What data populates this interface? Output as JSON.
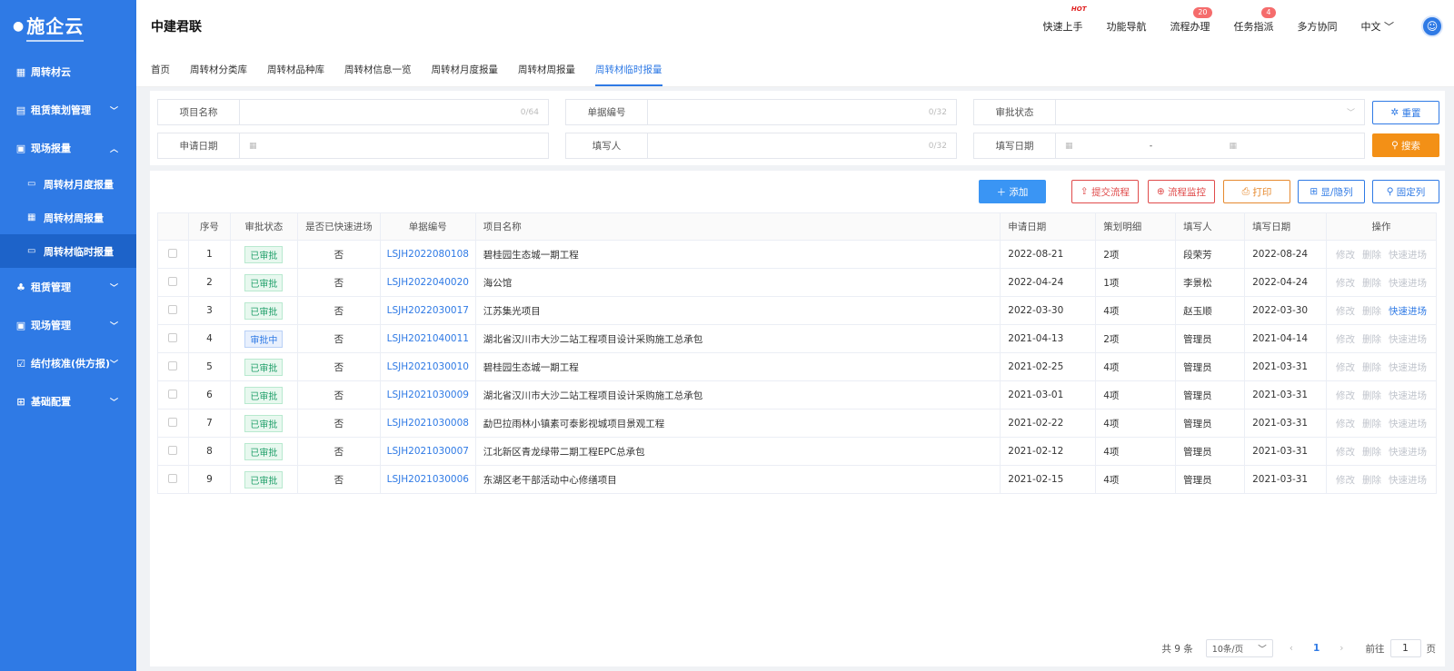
{
  "sidebar": {
    "logo": "施企云",
    "items": [
      {
        "label": "周转材云",
        "icon": "grid-icon"
      },
      {
        "label": "租赁策划管理",
        "icon": "doc-icon"
      },
      {
        "label": "现场报量",
        "icon": "form-icon"
      },
      {
        "label": "周转材月度报量",
        "icon": "doc-search-icon"
      },
      {
        "label": "周转材周报量",
        "icon": "calendar-icon"
      },
      {
        "label": "周转材临时报量",
        "icon": "card-icon"
      },
      {
        "label": "租赁管理",
        "icon": "org-icon"
      },
      {
        "label": "现场管理",
        "icon": "form-icon"
      },
      {
        "label": "结付核准(供方报)",
        "icon": "clipboard-check-icon"
      },
      {
        "label": "基础配置",
        "icon": "apps-icon"
      }
    ]
  },
  "header": {
    "company": "中建君联",
    "nav": [
      {
        "label": "快速上手",
        "tag": "HOT"
      },
      {
        "label": "功能导航"
      },
      {
        "label": "流程办理",
        "badge": "20"
      },
      {
        "label": "任务指派",
        "badge": "4"
      },
      {
        "label": "多方协同"
      },
      {
        "label": "中文"
      }
    ]
  },
  "tabs": [
    "首页",
    "周转材分类库",
    "周转材品种库",
    "周转材信息一览",
    "周转材月度报量",
    "周转材周报量",
    "周转材临时报量"
  ],
  "filters": {
    "project_name": {
      "label": "项目名称",
      "count": "0/64"
    },
    "doc_no": {
      "label": "单据编号",
      "count": "0/32"
    },
    "approval": {
      "label": "审批状态"
    },
    "apply_date": {
      "label": "申请日期"
    },
    "filler": {
      "label": "填写人",
      "count": "0/32"
    },
    "fill_date": {
      "label": "填写日期",
      "sep": "-"
    },
    "reset": "重置",
    "search": "搜索"
  },
  "toolbar": {
    "add": "添加",
    "submit": "提交流程",
    "monitor": "流程监控",
    "print": "打印",
    "toggle_cols": "显/隐列",
    "fix_cols": "固定列"
  },
  "table": {
    "headers": [
      "序号",
      "审批状态",
      "是否已快速进场",
      "单据编号",
      "项目名称",
      "申请日期",
      "策划明细",
      "填写人",
      "填写日期",
      "操作"
    ],
    "rows": [
      {
        "no": "1",
        "status": "已审批",
        "fast": "否",
        "code": "LSJH2022080108",
        "project": "碧桂园生态城一期工程",
        "apply": "2022-08-21",
        "detail": "2项",
        "filler": "段荣芳",
        "fill": "2022-08-24"
      },
      {
        "no": "2",
        "status": "已审批",
        "fast": "否",
        "code": "LSJH2022040020",
        "project": "海公馆",
        "apply": "2022-04-24",
        "detail": "1项",
        "filler": "李景松",
        "fill": "2022-04-24"
      },
      {
        "no": "3",
        "status": "已审批",
        "fast": "否",
        "code": "LSJH2022030017",
        "project": "江苏集光项目",
        "apply": "2022-03-30",
        "detail": "4项",
        "filler": "赵玉顺",
        "fill": "2022-03-30"
      },
      {
        "no": "4",
        "status": "审批中",
        "fast": "否",
        "code": "LSJH2021040011",
        "project": "湖北省汉川市大沙二站工程项目设计采购施工总承包",
        "apply": "2021-04-13",
        "detail": "2项",
        "filler": "管理员",
        "fill": "2021-04-14"
      },
      {
        "no": "5",
        "status": "已审批",
        "fast": "否",
        "code": "LSJH2021030010",
        "project": "碧桂园生态城一期工程",
        "apply": "2021-02-25",
        "detail": "4项",
        "filler": "管理员",
        "fill": "2021-03-31"
      },
      {
        "no": "6",
        "status": "已审批",
        "fast": "否",
        "code": "LSJH2021030009",
        "project": "湖北省汉川市大沙二站工程项目设计采购施工总承包",
        "apply": "2021-03-01",
        "detail": "4项",
        "filler": "管理员",
        "fill": "2021-03-31"
      },
      {
        "no": "7",
        "status": "已审批",
        "fast": "否",
        "code": "LSJH2021030008",
        "project": "勐巴拉雨林小镇素可泰影视城项目景观工程",
        "apply": "2021-02-22",
        "detail": "4项",
        "filler": "管理员",
        "fill": "2021-03-31"
      },
      {
        "no": "8",
        "status": "已审批",
        "fast": "否",
        "code": "LSJH2021030007",
        "project": "江北新区青龙绿带二期工程EPC总承包",
        "apply": "2021-02-12",
        "detail": "4项",
        "filler": "管理员",
        "fill": "2021-03-31"
      },
      {
        "no": "9",
        "status": "已审批",
        "fast": "否",
        "code": "LSJH2021030006",
        "project": "东湖区老干部活动中心修缮项目",
        "apply": "2021-02-15",
        "detail": "4项",
        "filler": "管理员",
        "fill": "2021-03-31"
      }
    ],
    "ops": [
      "修改",
      "删除",
      "快速进场"
    ]
  },
  "pager": {
    "total": "共 9 条",
    "size": "10条/页",
    "page": "1",
    "goto": "前往",
    "goto_val": "1",
    "suffix": "页"
  }
}
